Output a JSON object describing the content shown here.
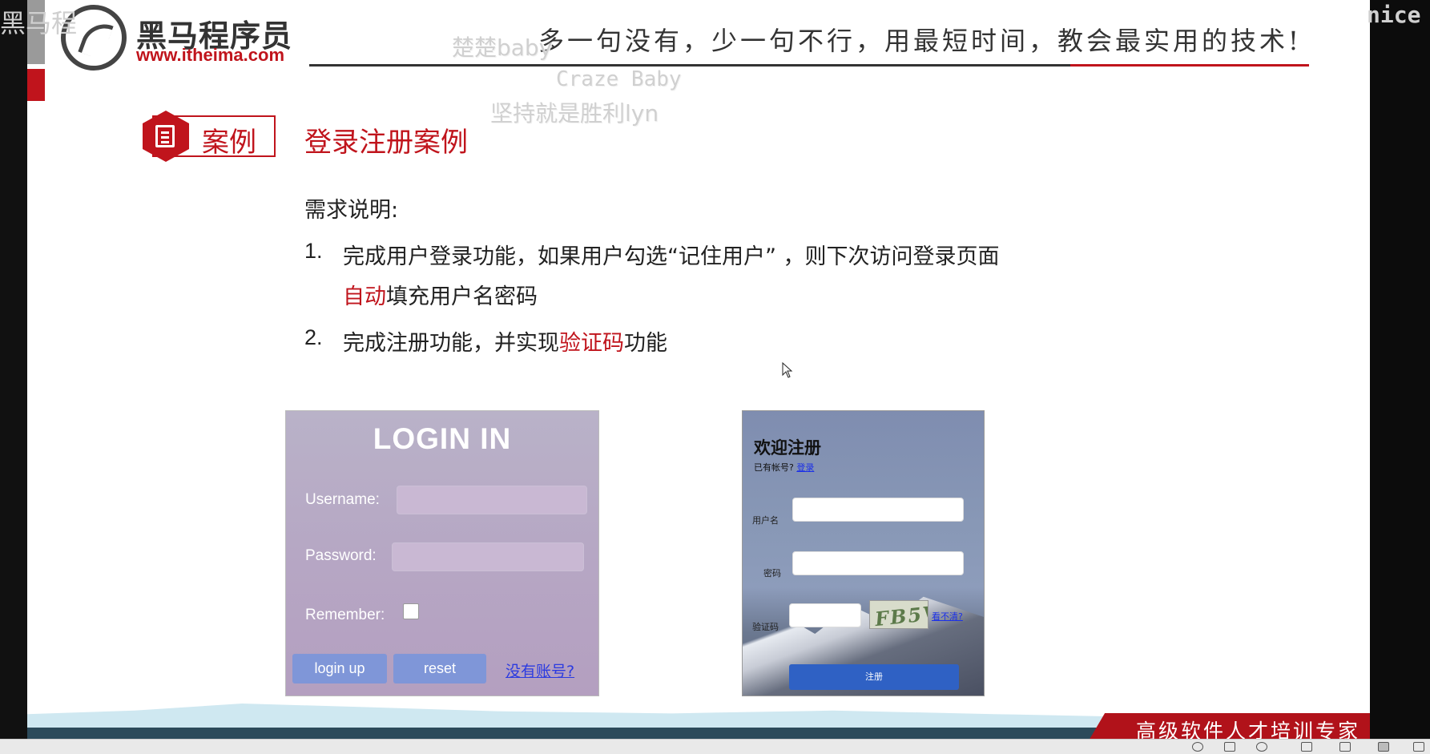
{
  "header": {
    "logo_cn": "黑马程序员",
    "logo_url": "www.itheima.com",
    "motto": "多一句没有，少一句不行，用最短时间，教会最实用的技术!"
  },
  "watermarks": {
    "top_left": "黑马程",
    "line1": "楚楚baby",
    "line2": "Craze Baby",
    "line3": "坚持就是胜利lyn",
    "right": "nice"
  },
  "case": {
    "label": "案例",
    "title": "登录注册案例"
  },
  "requirements": {
    "heading": "需求说明:",
    "item1_num": "1.",
    "item1_line1": "完成用户登录功能，如果用户勾选“记住用户” ，则下次访问登录页面",
    "item1_line2_red": "自动",
    "item1_line2_rest": "填充用户名密码",
    "item2_num": "2.",
    "item2_pre": "完成注册功能，并实现",
    "item2_red": "验证码",
    "item2_post": "功能"
  },
  "login_panel": {
    "title": "LOGIN IN",
    "username_label": "Username:",
    "password_label": "Password:",
    "remember_label": "Remember:",
    "login_button": "login up",
    "reset_button": "reset",
    "no_account_link": "没有账号?"
  },
  "register_panel": {
    "title": "欢迎注册",
    "has_account": "已有帐号?",
    "login_link": "登录",
    "username_label": "用户名",
    "password_label": "密码",
    "captcha_label": "验证码",
    "captcha_text": "FB5V",
    "change_link": "看不清?",
    "submit_button": "注册"
  },
  "footer": {
    "slogan": "高级软件人才培训专家"
  },
  "colors": {
    "accent_red": "#c0141c",
    "login_bg": "#b6a7c4",
    "register_button": "#2f61c4"
  }
}
